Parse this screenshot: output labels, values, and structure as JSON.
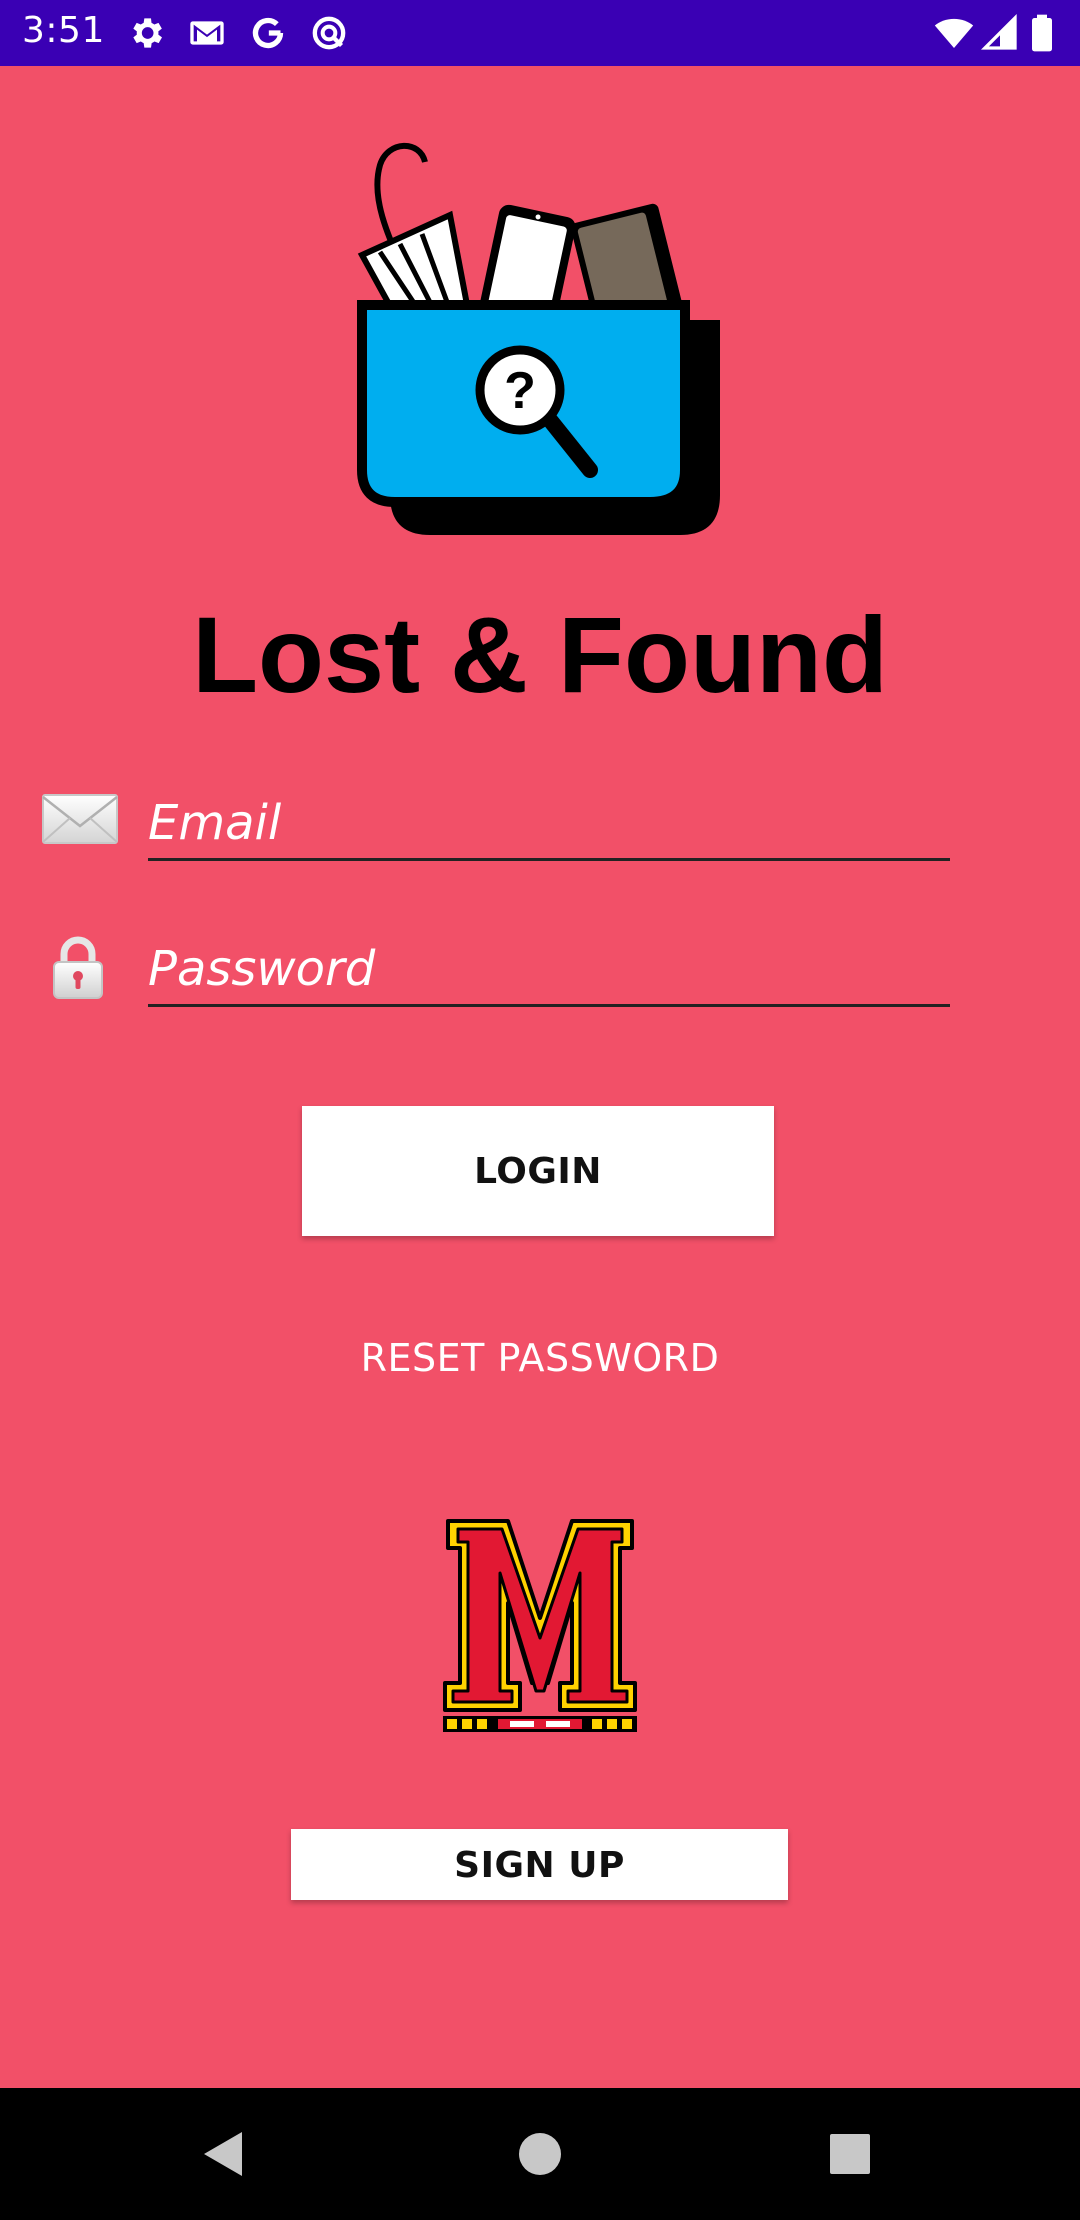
{
  "status_bar": {
    "time": "3:51",
    "icons_left": [
      "gear-icon",
      "gmail-icon",
      "google-icon",
      "vpn-icon"
    ],
    "icons_right": [
      "wifi-icon",
      "signal-icon",
      "battery-icon"
    ],
    "background": "#3a00b4"
  },
  "app": {
    "title": "Lost & Found",
    "background": "#f25068"
  },
  "email": {
    "placeholder": "Email",
    "value": "",
    "icon": "envelope-icon"
  },
  "password": {
    "placeholder": "Password",
    "value": "",
    "icon": "lock-icon"
  },
  "actions": {
    "login_label": "LOGIN",
    "reset_label": "RESET PASSWORD",
    "signup_label": "SIGN UP"
  },
  "nav": {
    "icons": [
      "back-icon",
      "home-icon",
      "recents-icon"
    ]
  }
}
